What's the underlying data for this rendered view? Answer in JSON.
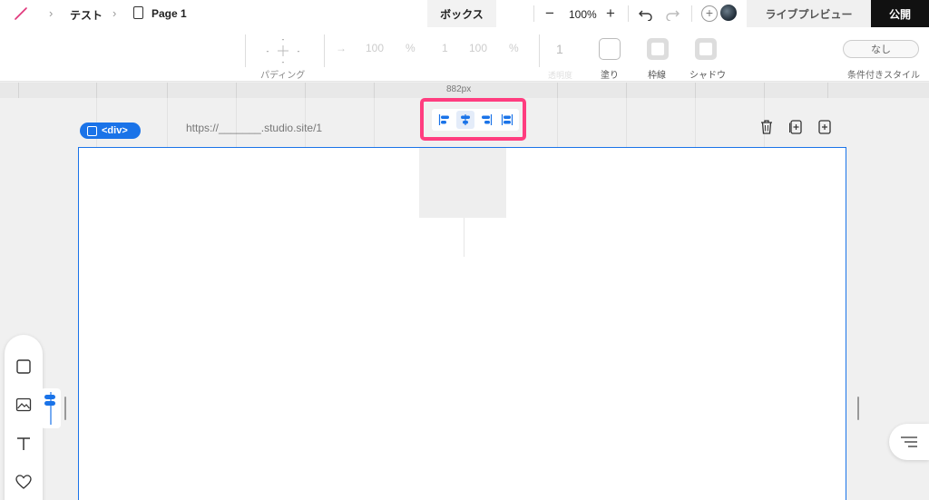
{
  "topbar": {
    "breadcrumb_project": "テスト",
    "breadcrumb_page": "Page 1",
    "active_tab": "ボックス",
    "zoom": "100%",
    "live_preview": "ライブプレビュー",
    "publish": "公開"
  },
  "properties": {
    "padding_label": "パディング",
    "width_value": "100",
    "width_unit": "%",
    "ratio_value": "1",
    "height_value": "100",
    "height_unit": "%",
    "opacity_value": "1",
    "opacity_label": "透明度",
    "fill_label": "塗り",
    "border_label": "枠線",
    "shadow_label": "シャドウ",
    "conditional_value": "なし",
    "conditional_label": "条件付きスタイル"
  },
  "ruler": {
    "width_label": "882px"
  },
  "canvas": {
    "element_tag": "<div>",
    "url": "https://_______.studio.site/1"
  },
  "alignment": {
    "buttons": [
      "align-left",
      "align-center",
      "align-right",
      "align-stretch"
    ],
    "active": "align-center"
  },
  "colors": {
    "accent": "#1a73e8",
    "highlight": "#ff3d7f",
    "publish_bg": "#111111"
  }
}
